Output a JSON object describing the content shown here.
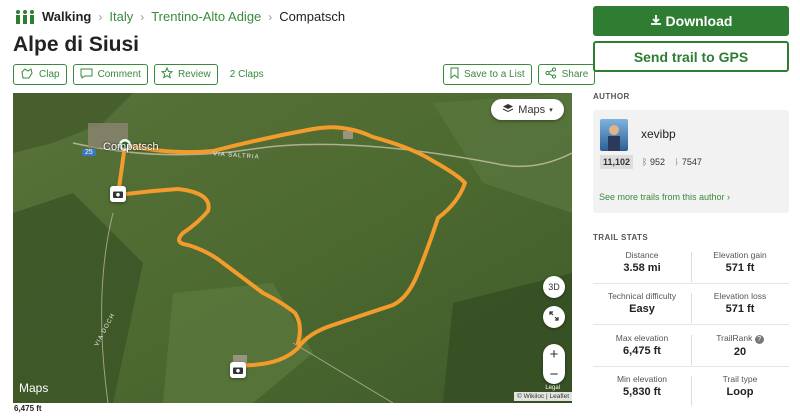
{
  "breadcrumb": {
    "activity": "Walking",
    "items": [
      "Italy",
      "Trentino-Alto Adige",
      "Compatsch"
    ]
  },
  "trail": {
    "title": "Alpe di Siusi"
  },
  "actions": {
    "clap": "Clap",
    "comment": "Comment",
    "review": "Review",
    "claps_count": "2 Claps",
    "save": "Save to a List",
    "share": "Share"
  },
  "map": {
    "layer_toggle": "Maps",
    "town_label": "Compatsch",
    "road_label": "VIA SALTRIA",
    "road_label2": "VIA DOCH",
    "road_badge": "25",
    "btn_3d": "3D",
    "zoom_in": "+",
    "zoom_out": "−",
    "logo": "Maps",
    "legal": "Legal",
    "attribution": "© Wikiloc | Leaflet"
  },
  "elevation_axis": {
    "top_label": "6,475 ft"
  },
  "sidebar": {
    "download": "Download",
    "send_gps": "Send trail to GPS",
    "author_heading": "AUTHOR",
    "author_name": "xevibp",
    "trails": "11,102",
    "followers": "952",
    "following": "7547",
    "author_link": "See more trails from this author ›",
    "stats_heading": "TRAIL STATS"
  },
  "stats": [
    {
      "label": "Distance",
      "value": "3.58 mi"
    },
    {
      "label": "Elevation gain",
      "value": "571 ft"
    },
    {
      "label": "Technical difficulty",
      "value": "Easy"
    },
    {
      "label": "Elevation loss",
      "value": "571 ft"
    },
    {
      "label": "Max elevation",
      "value": "6,475 ft"
    },
    {
      "label": "TrailRank",
      "value": "20"
    },
    {
      "label": "Min elevation",
      "value": "5,830 ft"
    },
    {
      "label": "Trail type",
      "value": "Loop"
    }
  ],
  "colors": {
    "brand": "#2e7d32",
    "route": "#f39c2c"
  }
}
